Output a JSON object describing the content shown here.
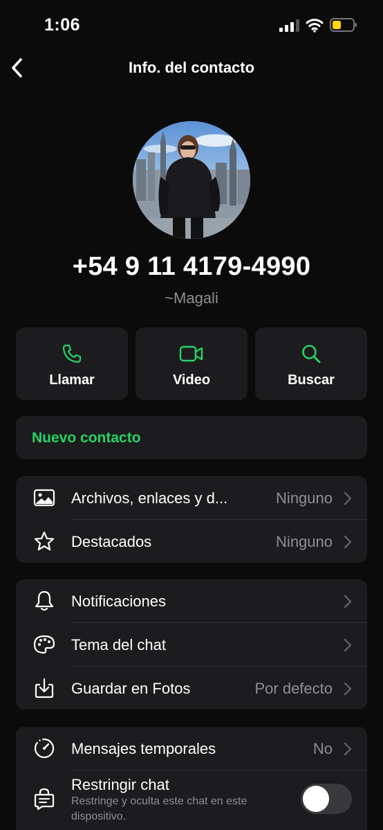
{
  "status_bar": {
    "time": "1:06"
  },
  "nav": {
    "title": "Info. del contacto"
  },
  "profile": {
    "phone": "+54 9 11 4179-4990",
    "name": "~Magali"
  },
  "actions": [
    {
      "label": "Llamar",
      "icon": "phone-icon"
    },
    {
      "label": "Video",
      "icon": "video-icon"
    },
    {
      "label": "Buscar",
      "icon": "search-icon"
    }
  ],
  "new_contact": {
    "label": "Nuevo contacto"
  },
  "media_group": {
    "media": {
      "label": "Archivos, enlaces y d...",
      "value": "Ninguno",
      "icon": "photo-icon"
    },
    "starred": {
      "label": "Destacados",
      "value": "Ninguno",
      "icon": "star-icon"
    }
  },
  "settings_group": {
    "notifications": {
      "label": "Notificaciones",
      "icon": "bell-icon"
    },
    "theme": {
      "label": "Tema del chat",
      "icon": "palette-icon"
    },
    "save_photos": {
      "label": "Guardar en Fotos",
      "value": "Por defecto",
      "icon": "download-icon"
    }
  },
  "privacy_group": {
    "disappearing": {
      "label": "Mensajes temporales",
      "value": "No",
      "icon": "timer-icon"
    },
    "restrict": {
      "label": "Restringir chat",
      "sub": "Restringe y oculta este chat en este dispositivo.",
      "icon": "lock-chat-icon",
      "enabled": false
    }
  },
  "colors": {
    "accent": "#25d366",
    "background": "#0b0b0b",
    "card": "#1c1c1e",
    "secondary_text": "#8e8e93",
    "battery": "#ffd60a"
  }
}
